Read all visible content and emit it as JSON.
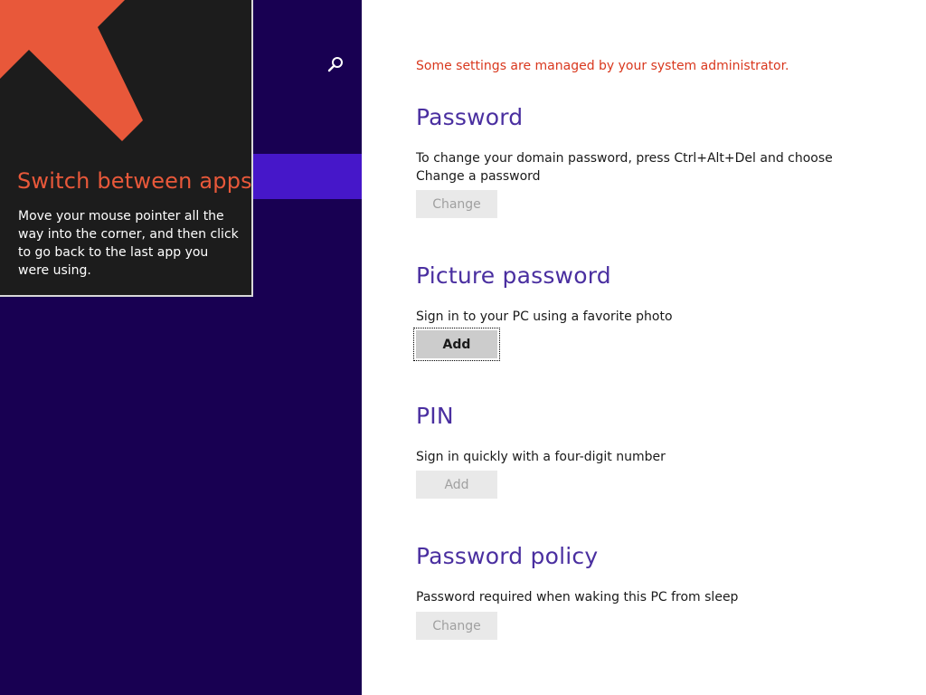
{
  "nav": {
    "search_icon": "search-icon"
  },
  "tip": {
    "title": "Switch between apps",
    "body": "Move your mouse pointer all the way into the corner, and then click to go back to the last app you were using.",
    "arrow_color": "#e8583a"
  },
  "content": {
    "admin_notice": "Some settings are managed by your system administrator.",
    "sections": [
      {
        "title": "Password",
        "desc": "To change your domain password, press Ctrl+Alt+Del and choose Change a password",
        "button": "Change",
        "button_enabled": false
      },
      {
        "title": "Picture password",
        "desc": "Sign in to your PC using a favorite photo",
        "button": "Add",
        "button_enabled": true
      },
      {
        "title": "PIN",
        "desc": "Sign in quickly with a four-digit number",
        "button": "Add",
        "button_enabled": false
      },
      {
        "title": "Password policy",
        "desc": "Password required when waking this PC from sleep",
        "button": "Change",
        "button_enabled": false
      }
    ]
  },
  "colors": {
    "nav_background": "#180052",
    "nav_selected": "#4617c9",
    "heading": "#4a2fa0",
    "notice": "#d9381e"
  }
}
